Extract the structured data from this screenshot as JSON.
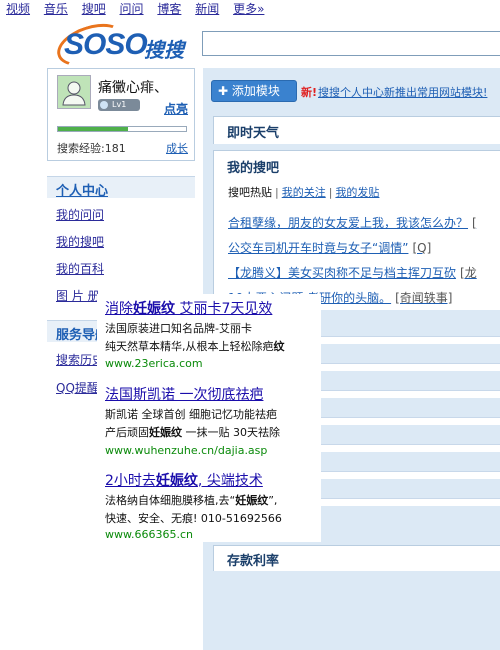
{
  "topnav": [
    "视频",
    "音乐",
    "搜吧",
    "问问",
    "博客",
    "新闻",
    "更多»"
  ],
  "logo": {
    "brand": "SOSO",
    "cn": "搜搜"
  },
  "profile": {
    "username": "痛黴心痱、",
    "level_badge": "Lv1",
    "light_link": "点亮",
    "exp_label": "搜索经验:181",
    "exp_progress": 0.55,
    "grow_link": "成长"
  },
  "menu": {
    "header": "个人中心",
    "items": [
      "我的问问",
      "我的搜吧",
      "我的百科",
      "图 片 册"
    ],
    "service_header": "服务导航",
    "service_items": [
      "搜索历史",
      "QQ提醒"
    ]
  },
  "main": {
    "add_button": "添加模块",
    "new_tag": "新!",
    "new_link": "搜搜个人中心新推出常用网站模块!",
    "weather_title": "即时天气",
    "mysoba_title": "我的搜吧",
    "tabs": [
      "搜吧热贴",
      "我的关注",
      "我的发贴"
    ],
    "posts": [
      {
        "title": "合租孽缘，朋友的女友爱上我，我该怎么办？",
        "tag": "["
      },
      {
        "title": "公交车司机开车时竟与女子“调情”",
        "tag": "[Q]"
      },
      {
        "title": "【龙腾义】美女买肉称不足与档主挥刀互砍",
        "tag": "[龙"
      },
      {
        "title": "10大恶心问题  考研你的头脑。",
        "tag": "[奇闻轶事]"
      }
    ],
    "rate_title": "存款利率"
  },
  "ad": {
    "items": [
      {
        "head_pre": "消除",
        "head_kw": "妊娠纹",
        "head_post": " 艾丽卡7天见效",
        "line1": "法国原装进口知名品牌-艾丽卡",
        "line2_pre": "纯天然草本精华,从根本上轻松除疤",
        "line2_kw": "纹",
        "url": "www.23erica.com"
      },
      {
        "head_pre": "法国斯凯诺 一次彻底祛疤",
        "head_kw": "",
        "head_post": "",
        "line1": "斯凯诺 全球首创 细胞记忆功能祛疤",
        "line2_pre": "产后顽固",
        "line2_kw": "妊娠纹",
        "line2_post": " 一抹一贴 30天祛除",
        "url": "www.wuhenzuhe.cn/dajia.asp"
      },
      {
        "head_pre": "2小时去",
        "head_kw": "妊娠纹",
        "head_post": ", 尖端技术",
        "line1_pre": "法格纳自体细胞膜移植,去“",
        "line1_kw": "妊娠纹",
        "line1_post": "”,",
        "line2": "快速、安全、无痕! 010-51692566",
        "url": "www.666365.cn"
      }
    ]
  },
  "colors": {
    "accent": "#1e5fb4",
    "panel_bg": "#dce9f5",
    "add_button": "#3a82cf",
    "url_green": "#0a8a0a"
  }
}
